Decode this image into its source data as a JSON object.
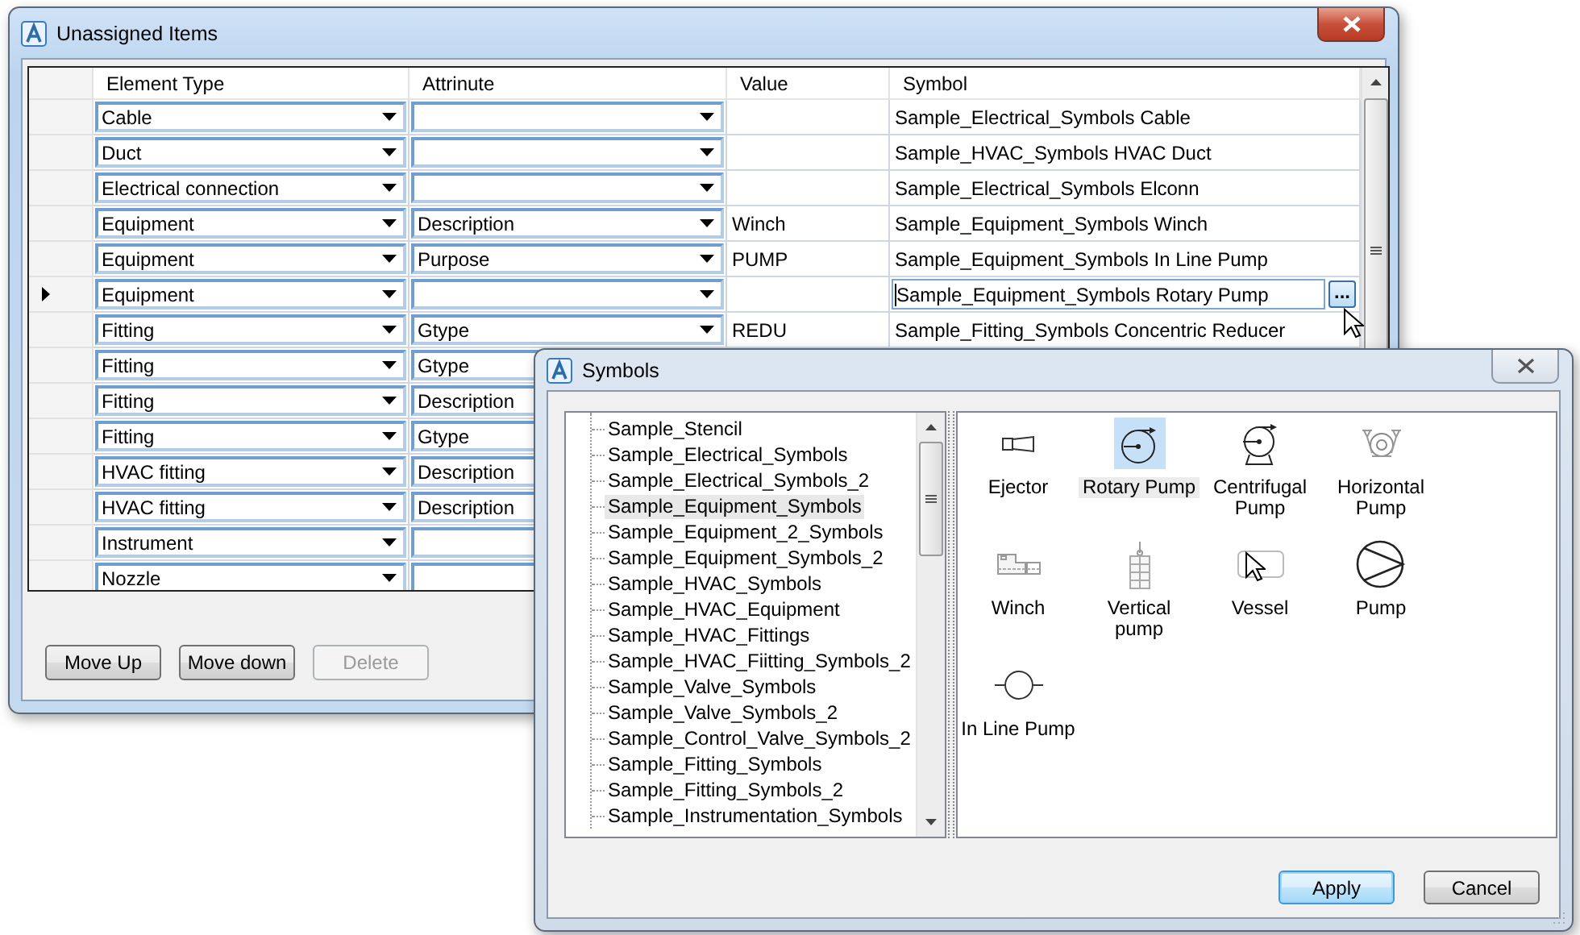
{
  "main_window": {
    "title": "Unassigned Items",
    "columns": [
      "Element Type",
      "Attrinute",
      "Value",
      "Symbol"
    ],
    "rows": [
      {
        "selected": false,
        "element_type": "Cable",
        "symbol": "Sample_Electrical_Symbols Cable"
      },
      {
        "selected": false,
        "element_type": "Duct",
        "symbol": "Sample_HVAC_Symbols HVAC Duct"
      },
      {
        "selected": false,
        "element_type": "Electrical connection",
        "symbol": "Sample_Electrical_Symbols Elconn"
      },
      {
        "selected": false,
        "element_type": "Equipment",
        "attribute": "Description",
        "value": "Winch",
        "symbol": "Sample_Equipment_Symbols Winch"
      },
      {
        "selected": false,
        "element_type": "Equipment",
        "attribute": "Purpose",
        "value": "PUMP",
        "symbol": "Sample_Equipment_Symbols In Line Pump"
      },
      {
        "selected": true,
        "element_type": "Equipment",
        "symbol": "Sample_Equipment_Symbols Rotary Pump",
        "browse_button": "..."
      },
      {
        "selected": false,
        "element_type": "Fitting",
        "attribute": "Gtype",
        "value": "REDU",
        "symbol": "Sample_Fitting_Symbols Concentric Reducer"
      },
      {
        "selected": false,
        "element_type": "Fitting",
        "attribute": "Gtype"
      },
      {
        "selected": false,
        "element_type": "Fitting",
        "attribute": "Description"
      },
      {
        "selected": false,
        "element_type": "Fitting",
        "attribute": "Gtype"
      },
      {
        "selected": false,
        "element_type": "HVAC fitting",
        "attribute": "Description"
      },
      {
        "selected": false,
        "element_type": "HVAC fitting",
        "attribute": "Description"
      },
      {
        "selected": false,
        "element_type": "Instrument"
      },
      {
        "selected": false,
        "element_type": "Nozzle"
      }
    ],
    "buttons": [
      {
        "label": "Move Up",
        "disabled": false
      },
      {
        "label": "Move down",
        "disabled": false
      },
      {
        "label": "Delete",
        "disabled": true
      }
    ]
  },
  "symbols_dialog": {
    "title": "Symbols",
    "libraries": [
      {
        "label": "Sample_Stencil",
        "selected": false
      },
      {
        "label": "Sample_Electrical_Symbols",
        "selected": false
      },
      {
        "label": "Sample_Electrical_Symbols_2",
        "selected": false
      },
      {
        "label": "Sample_Equipment_Symbols",
        "selected": true
      },
      {
        "label": "Sample_Equipment_2_Symbols",
        "selected": false
      },
      {
        "label": "Sample_Equipment_Symbols_2",
        "selected": false
      },
      {
        "label": "Sample_HVAC_Symbols",
        "selected": false
      },
      {
        "label": "Sample_HVAC_Equipment",
        "selected": false
      },
      {
        "label": "Sample_HVAC_Fittings",
        "selected": false
      },
      {
        "label": "Sample_HVAC_Fiitting_Symbols_2",
        "selected": false
      },
      {
        "label": "Sample_Valve_Symbols",
        "selected": false
      },
      {
        "label": "Sample_Valve_Symbols_2",
        "selected": false
      },
      {
        "label": "Sample_Control_Valve_Symbols_2",
        "selected": false
      },
      {
        "label": "Sample_Fitting_Symbols",
        "selected": false
      },
      {
        "label": "Sample_Fitting_Symbols_2",
        "selected": false
      },
      {
        "label": "Sample_Instrumentation_Symbols",
        "selected": false
      }
    ],
    "symbols": [
      {
        "label": "Ejector",
        "kind": "ejector",
        "selected": false
      },
      {
        "label": "Rotary Pump",
        "kind": "rotary",
        "selected": true
      },
      {
        "label": "Centrifugal Pump",
        "kind": "centrifugal",
        "selected": false
      },
      {
        "label": "Horizontal Pump",
        "kind": "horizontal",
        "selected": false
      },
      {
        "label": "Winch",
        "kind": "winch",
        "selected": false
      },
      {
        "label": "Vertical pump",
        "kind": "vertical",
        "selected": false
      },
      {
        "label": "Vessel",
        "kind": "vessel",
        "selected": false
      },
      {
        "label": "Pump",
        "kind": "pump",
        "selected": false
      },
      {
        "label": "In Line Pump",
        "kind": "inline",
        "selected": false
      }
    ],
    "buttons": [
      {
        "label": "Apply",
        "default": true
      },
      {
        "label": "Cancel",
        "default": false
      }
    ]
  }
}
